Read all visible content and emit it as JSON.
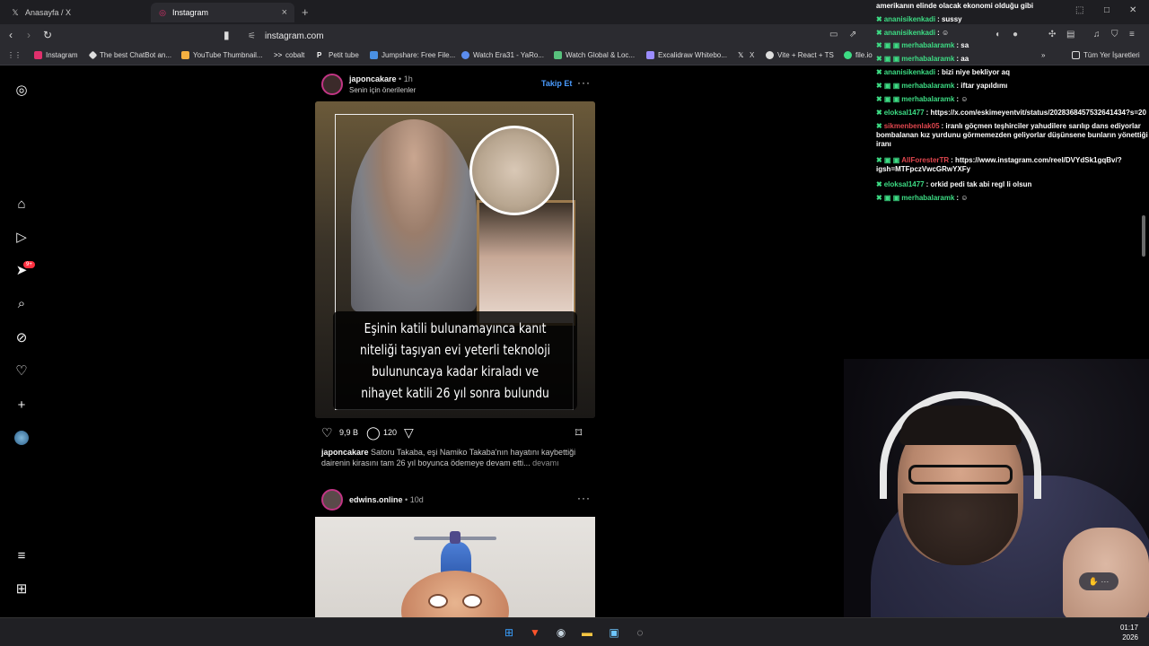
{
  "browser": {
    "tabs": [
      {
        "title": "Anasayfa / X",
        "icon": "x-logo-icon"
      },
      {
        "title": "Instagram",
        "icon": "instagram-icon"
      }
    ],
    "url": "instagram.com",
    "bookmarks": [
      {
        "label": "Instagram",
        "color": "#e1306c"
      },
      {
        "label": "The best ChatBot an...",
        "color": "#dddddd"
      },
      {
        "label": "YouTube Thumbnail...",
        "color": "#f5b041"
      },
      {
        "label": "cobalt",
        "color": "#ffffff"
      },
      {
        "label": "Petit tube",
        "color": "#ffffff"
      },
      {
        "label": "Jumpshare: Free File...",
        "color": "#4a90e2"
      },
      {
        "label": "Watch Era31 - YaRo...",
        "color": "#5b8def"
      },
      {
        "label": "Watch Global & Loc...",
        "color": "#58c27d"
      },
      {
        "label": "Excalidraw Whitebo...",
        "color": "#9b8cff"
      },
      {
        "label": "X",
        "color": "#ffffff"
      },
      {
        "label": "Vite + React + TS",
        "color": "#dddddd"
      },
      {
        "label": "file.io",
        "color": "#3ddc84"
      }
    ],
    "bookmarks_all": "Tüm Yer İşaretleri"
  },
  "instagram": {
    "nav_badge": "9+",
    "post1": {
      "username": "japoncakare",
      "time": "1h",
      "subtitle": "Senin için önerilenler",
      "follow": "Takip Et",
      "image_caption": "Eşinin katili bulunamayınca kanıt\nniteliği taşıyan evi yeterli teknoloji\nbulununcaya kadar kiraladı ve\nnihayet katili 26 yıl sonra bulundu",
      "likes": "9,9 B",
      "comments": "120",
      "caption_user": "japoncakare",
      "caption_text": "Satoru Takaba, eşi Namiko Takaba'nın hayatını kaybettiği dairenin kirasını tam 26 yıl boyunca ödemeye devam etti...",
      "more": "devamı"
    },
    "post2": {
      "username": "edwins.online",
      "time": "10d"
    }
  },
  "chat": [
    {
      "nick": "",
      "nick_color": "#ffffff",
      "text": "amerikanın elinde olacak ekonomi olduğu gibi",
      "badge": ""
    },
    {
      "nick": "ananisikenkadi",
      "nick_color": "#3ddc84",
      "text": ": sussy",
      "badge": "✖"
    },
    {
      "nick": "ananisikenkadi",
      "nick_color": "#3ddc84",
      "text": ": ☺",
      "badge": "✖"
    },
    {
      "nick": "merhabalaramk",
      "nick_color": "#3ddc84",
      "text": ": sa",
      "badge": "✖ ▣ ▣"
    },
    {
      "nick": "merhabalaramk",
      "nick_color": "#3ddc84",
      "text": ": aa",
      "badge": "✖ ▣ ▣"
    },
    {
      "nick": "ananisikenkadi",
      "nick_color": "#3ddc84",
      "text": ": bizi niye bekliyor aq",
      "badge": "✖"
    },
    {
      "nick": "merhabalaramk",
      "nick_color": "#3ddc84",
      "text": ": iftar yapıldımı",
      "badge": "✖ ▣ ▣"
    },
    {
      "nick": "merhabalaramk",
      "nick_color": "#3ddc84",
      "text": ": ☺",
      "badge": "✖ ▣ ▣"
    },
    {
      "nick": "eloksal1477",
      "nick_color": "#3ddc84",
      "text": ": https://x.com/eskimeyentvit/status/2028368457532641434?s=20",
      "badge": "✖"
    },
    {
      "nick": "sikmenbenlak05",
      "nick_color": "#e0464e",
      "text": ": iranlı göçmen teşhirciler yahudilere sarılıp dans ediyorlar bombalanan kız yurdunu görmemezden geliyorlar düşünsene bunların yönettiği iranı",
      "badge": "✖"
    },
    {
      "nick": "AllForesterTR",
      "nick_color": "#e0464e",
      "text": ": https://www.instagram.com/reel/DVYdSk1gqBv/?igsh=MTFpczVwcGRwYXFy",
      "badge": "✖ ▣ ▣"
    },
    {
      "nick": "eloksal1477",
      "nick_color": "#3ddc84",
      "text": ": orkid pedi tak abi regl li olsun",
      "badge": "✖"
    },
    {
      "nick": "merhabalaramk",
      "nick_color": "#3ddc84",
      "text": ": ☺",
      "badge": "✖ ▣ ▣"
    }
  ],
  "taskbar": {
    "time": "01:17",
    "year": "2026"
  }
}
